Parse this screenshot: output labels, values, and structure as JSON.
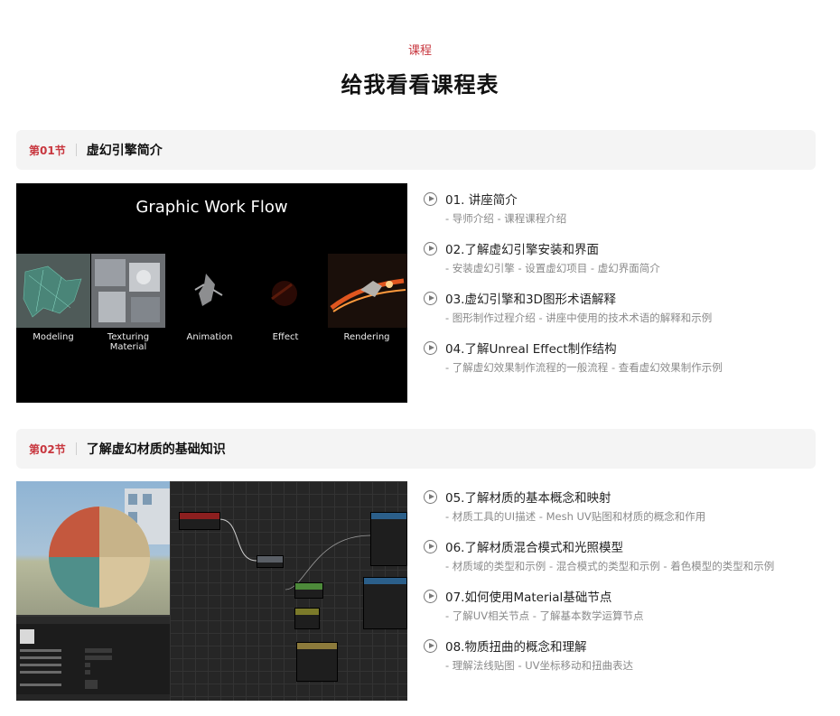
{
  "header": {
    "eyebrow": "课程",
    "title": "给我看看课程表"
  },
  "sections": [
    {
      "num": "第01节",
      "title": "虚幻引擎简介",
      "image": {
        "title": "Graphic Work Flow",
        "tiles": [
          "Modeling",
          "Texturing\nMaterial",
          "Animation",
          "Effect",
          "Rendering"
        ]
      },
      "lessons": [
        {
          "title": "01. 讲座简介",
          "sub": "- 导师介绍 - 课程课程介绍"
        },
        {
          "title": "02.了解虚幻引擎安装和界面",
          "sub": "- 安装虚幻引擎 - 设置虚幻项目 - 虚幻界面简介"
        },
        {
          "title": "03.虚幻引擎和3D图形术语解释",
          "sub": "- 图形制作过程介绍 - 讲座中使用的技术术语的解释和示例"
        },
        {
          "title": "04.了解Unreal Effect制作结构",
          "sub": "- 了解虚幻效果制作流程的一般流程 - 查看虚幻效果制作示例"
        }
      ]
    },
    {
      "num": "第02节",
      "title": "了解虚幻材质的基础知识",
      "lessons": [
        {
          "title": "05.了解材质的基本概念和映射",
          "sub": "- 材质工具的UI描述 - Mesh UV贴图和材质的概念和作用"
        },
        {
          "title": "06.了解材质混合模式和光照模型",
          "sub": "- 材质域的类型和示例 - 混合模式的类型和示例 - 着色模型的类型和示例"
        },
        {
          "title": "07.如何使用Material基础节点",
          "sub": "- 了解UV相关节点 - 了解基本数学运算节点"
        },
        {
          "title": "08.物质扭曲的概念和理解",
          "sub": "- 理解法线贴图 - UV坐标移动和扭曲表达"
        }
      ]
    }
  ],
  "colors": {
    "accent": "#c8373f"
  }
}
